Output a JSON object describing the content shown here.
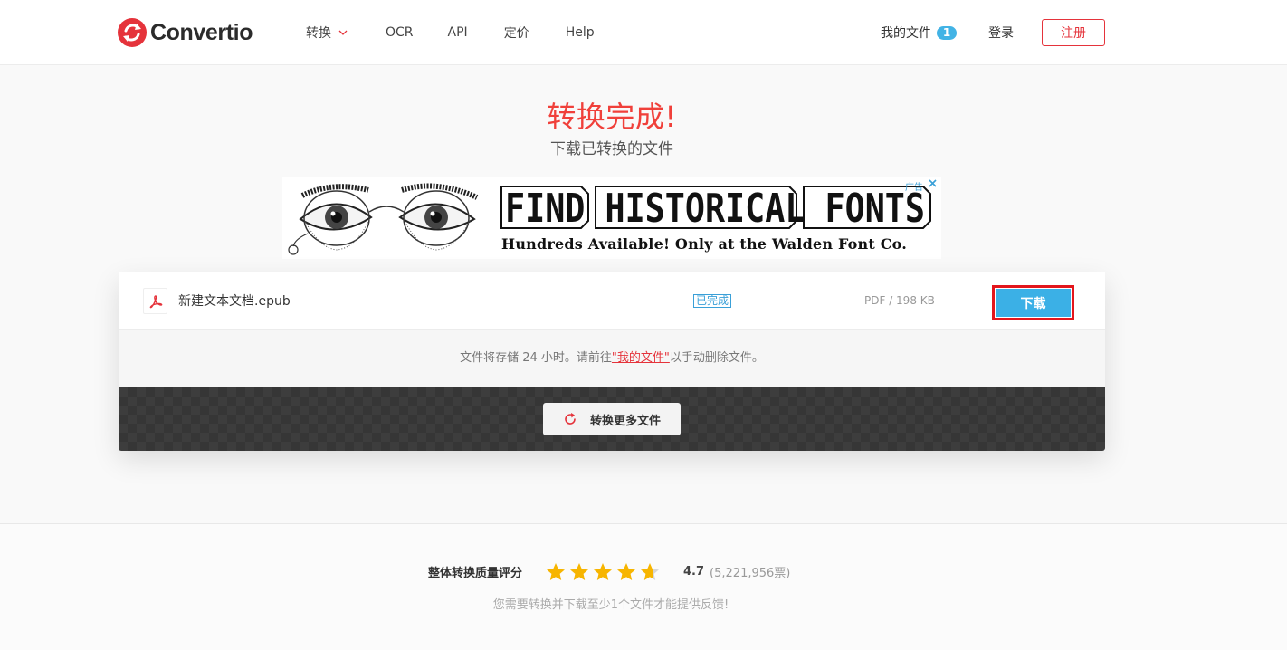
{
  "header": {
    "brand": "Convertio",
    "brand_color": "#e5333b",
    "nav": {
      "convert": "转换",
      "ocr": "OCR",
      "api": "API",
      "pricing": "定价",
      "help": "Help"
    },
    "my_files": "我的文件",
    "my_files_count": "1",
    "login": "登录",
    "signup": "注册"
  },
  "page": {
    "title": "转换完成!",
    "subtitle": "下载已转换的文件"
  },
  "ad": {
    "headline": "FIND HISTORICAL FONTS",
    "subline": "Hundreds Available! Only at the Walden Font Co.",
    "label": "广告"
  },
  "file": {
    "icon": "pdf-file-icon",
    "name": "新建文本文档.epub",
    "status": "已完成",
    "size": "PDF / 198 KB",
    "download": "下载",
    "accent": "#3bb0e6"
  },
  "note": {
    "before": "文件将存储 24 小时。请前往",
    "link": "\"我的文件\"",
    "after": "以手动删除文件。"
  },
  "more": {
    "label": "转换更多文件"
  },
  "footer": {
    "rating_label": "整体转换质量评分",
    "rating": 4.7,
    "rating_max": 5,
    "score": "4.7",
    "votes": "(5,221,956票)",
    "feedback": "您需要转换并下载至少1个文件才能提供反馈!"
  }
}
